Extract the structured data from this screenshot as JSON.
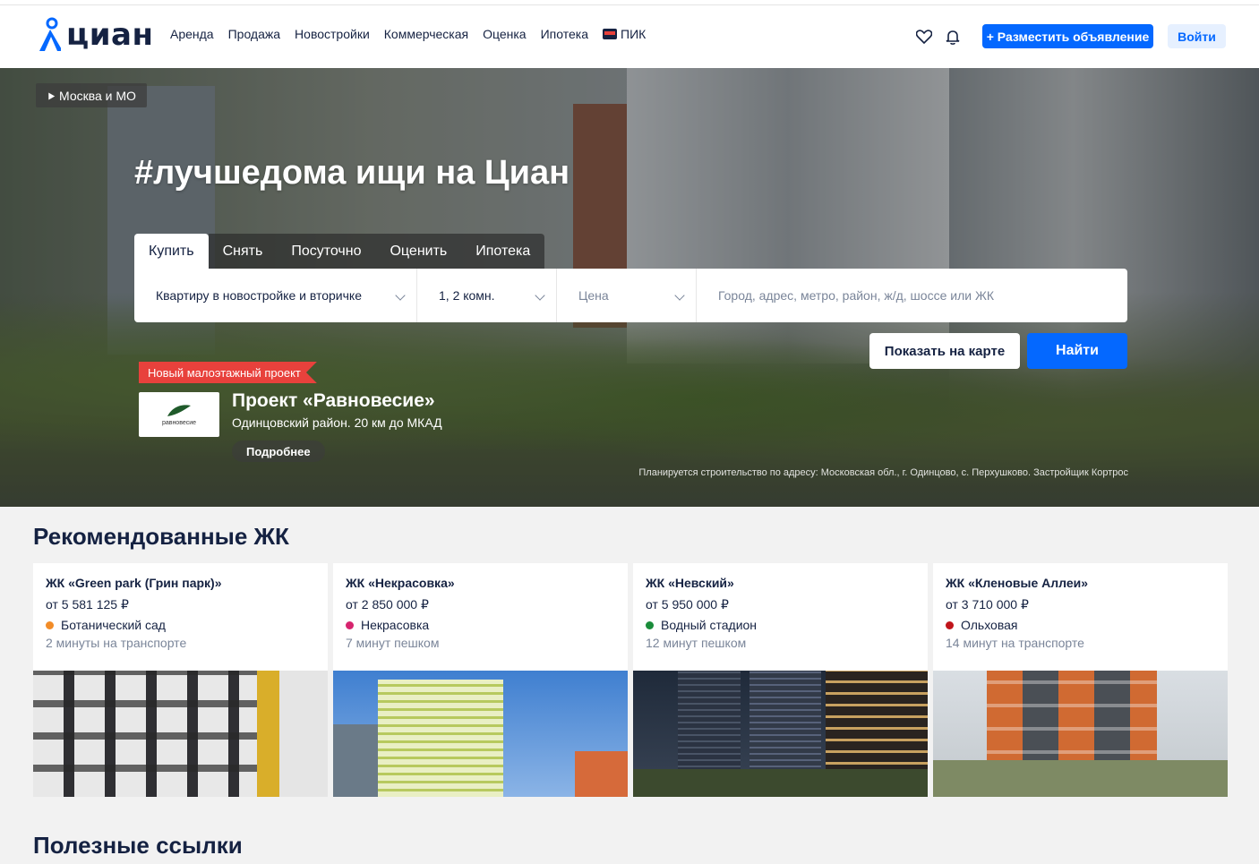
{
  "header": {
    "logo_text": "циан",
    "nav": [
      "Аренда",
      "Продажа",
      "Новостройки",
      "Коммерческая",
      "Оценка",
      "Ипотека",
      "ПИК"
    ],
    "post_button": "+ Разместить объявление",
    "login_button": "Войти",
    "icons": [
      "heart-icon",
      "bell-icon"
    ]
  },
  "hero": {
    "region": "Москва и МО",
    "title": "#лучшедома ищи на Циан",
    "tabs": [
      "Купить",
      "Снять",
      "Посуточно",
      "Оценить",
      "Ипотека"
    ],
    "active_tab": "Купить",
    "search": {
      "type_value": "Квартиру в новостройке и вторичке",
      "rooms_value": "1, 2 комн.",
      "price_placeholder": "Цена",
      "address_placeholder": "Город, адрес, метро, район, ж/д, шоссе или ЖК"
    },
    "map_button": "Показать на карте",
    "find_button": "Найти",
    "promo": {
      "tag": "Новый малоэтажный проект",
      "logo_text": "равновесие",
      "title": "Проект «Равновесие»",
      "subtitle": "Одинцовский район. 20 км до МКАД",
      "more": "Подробнее"
    },
    "disclaimer": "Планируется строительство по адресу: Московская обл., г. Одинцово, с. Перхушково. Застройщик Кортрос"
  },
  "recommended": {
    "title": "Рекомендованные ЖК",
    "items": [
      {
        "name": "ЖК «Green park (Грин парк)»",
        "price": "от 5 581 125 ₽",
        "metro": "Ботанический сад",
        "metro_color": "#f28c28",
        "time": "2 минуты на транспорте"
      },
      {
        "name": "ЖК «Некрасовка»",
        "price": "от 2 850 000 ₽",
        "metro": "Некрасовка",
        "metro_color": "#d6246e",
        "time": "7 минут пешком"
      },
      {
        "name": "ЖК «Невский»",
        "price": "от 5 950 000 ₽",
        "metro": "Водный стадион",
        "metro_color": "#1a8c3a",
        "time": "12 минут пешком"
      },
      {
        "name": "ЖК «Кленовые Аллеи»",
        "price": "от 3 710 000 ₽",
        "metro": "Ольховая",
        "metro_color": "#c0151b",
        "time": "14 минут на транспорте"
      }
    ]
  },
  "useful": {
    "title": "Полезные ссылки"
  },
  "colors": {
    "accent": "#0468ff",
    "text": "#152242",
    "muted": "#7a8599",
    "promo_red": "#e8413c"
  }
}
